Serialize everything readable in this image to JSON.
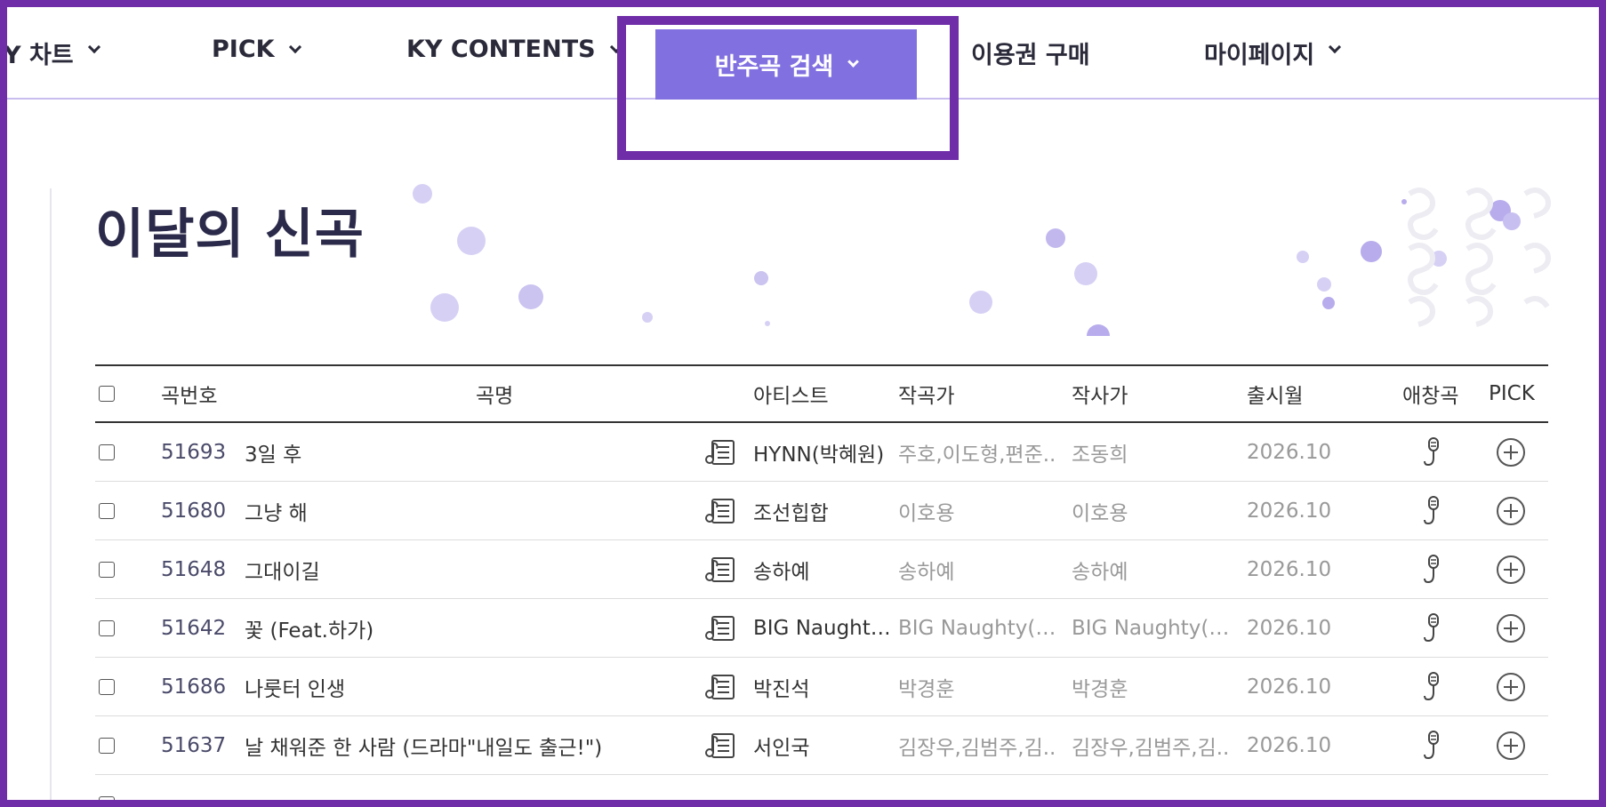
{
  "nav": {
    "items": [
      {
        "label": "Y 차트"
      },
      {
        "label": "PICK"
      },
      {
        "label": "KY CONTENTS"
      },
      {
        "label": "반주곡 검색"
      },
      {
        "label": "이용권 구매"
      },
      {
        "label": "마이페이지"
      }
    ]
  },
  "page": {
    "title": "이달의 신곡"
  },
  "table": {
    "headers": {
      "number": "곡번호",
      "title": "곡명",
      "artist": "아티스트",
      "composer": "작곡가",
      "lyricist": "작사가",
      "release": "출시월",
      "favorite": "애창곡",
      "pick": "PICK"
    },
    "rows": [
      {
        "number": "51693",
        "title": "3일 후",
        "artist": "HYNN(박혜원)",
        "composer": "주호,이도형,편준..",
        "lyricist": "조동희",
        "release": "2026.10"
      },
      {
        "number": "51680",
        "title": "그냥 해",
        "artist": "조선힙합",
        "composer": "이호용",
        "lyricist": "이호용",
        "release": "2026.10"
      },
      {
        "number": "51648",
        "title": "그대이길",
        "artist": "송하예",
        "composer": "송하예",
        "lyricist": "송하예",
        "release": "2026.10"
      },
      {
        "number": "51642",
        "title": "꽃 (Feat.하가)",
        "artist": "BIG Naught…",
        "composer": "BIG Naughty(…",
        "lyricist": "BIG Naughty(…",
        "release": "2026.10"
      },
      {
        "number": "51686",
        "title": "나룻터 인생",
        "artist": "박진석",
        "composer": "박경훈",
        "lyricist": "박경훈",
        "release": "2026.10"
      },
      {
        "number": "51637",
        "title": "날 채워준 한 사람 (드라마\"내일도 출근!\")",
        "artist": "서인국",
        "composer": "김장우,김범주,김..",
        "lyricist": "김장우,김범주,김..",
        "release": "2026.10"
      }
    ]
  },
  "colors": {
    "accent": "#8170e0",
    "frame": "#6f2da8",
    "title": "#2b2a4a",
    "bubble": "#c9c0ee"
  },
  "icons": [
    "chevron-down-icon",
    "music-sheet-icon",
    "microphone-icon",
    "plus-circle-icon",
    "checkbox-icon"
  ]
}
